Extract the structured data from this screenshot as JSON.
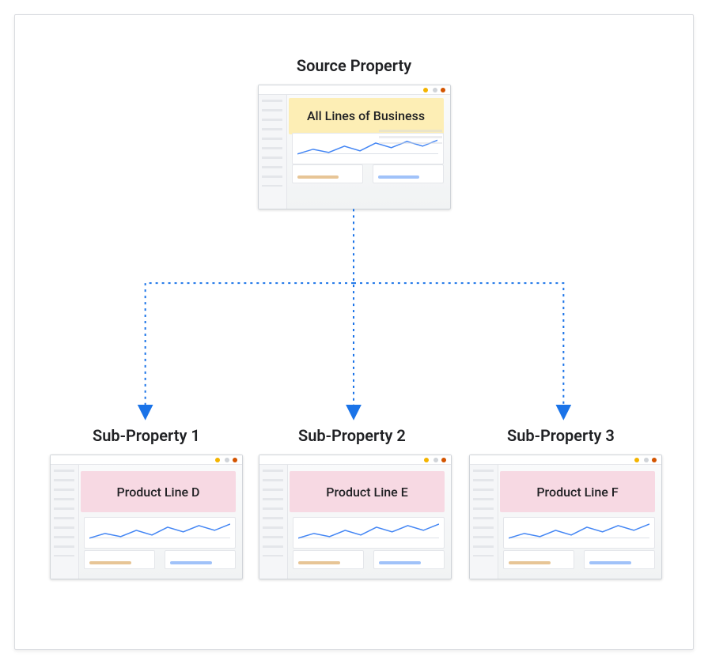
{
  "diagram": {
    "source": {
      "title": "Source Property",
      "overlay_label": "All Lines of Business"
    },
    "subs": [
      {
        "title": "Sub-Property 1",
        "overlay_label": "Product Line D"
      },
      {
        "title": "Sub-Property 2",
        "overlay_label": "Product Line E"
      },
      {
        "title": "Sub-Property 3",
        "overlay_label": "Product Line F"
      }
    ]
  }
}
